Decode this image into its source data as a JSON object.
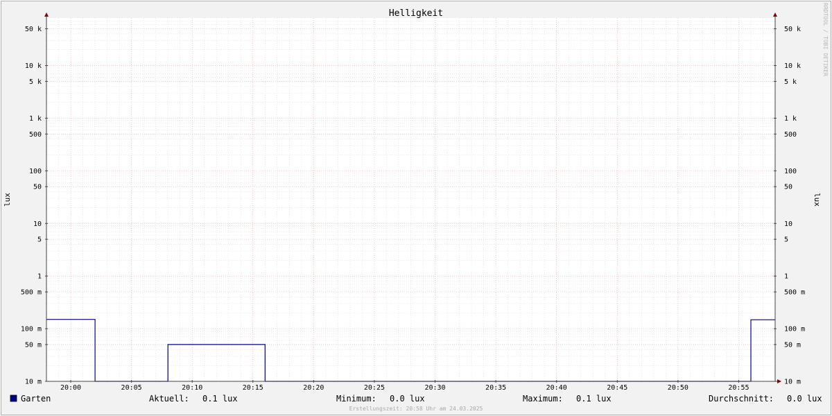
{
  "chart_data": {
    "type": "line",
    "title": "Helligkeit",
    "ylabel": "lux",
    "ylabel_right": "lux",
    "yscale": "log",
    "ylim": [
      0.01,
      80000
    ],
    "y_ticks": [
      {
        "value": 0.01,
        "label": "10 m"
      },
      {
        "value": 0.05,
        "label": "50 m"
      },
      {
        "value": 0.1,
        "label": "100 m"
      },
      {
        "value": 0.5,
        "label": "500 m"
      },
      {
        "value": 1,
        "label": "1"
      },
      {
        "value": 5,
        "label": "5"
      },
      {
        "value": 10,
        "label": "10"
      },
      {
        "value": 50,
        "label": "50"
      },
      {
        "value": 100,
        "label": "100"
      },
      {
        "value": 500,
        "label": "500"
      },
      {
        "value": 1000,
        "label": "1 k"
      },
      {
        "value": 5000,
        "label": "5 k"
      },
      {
        "value": 10000,
        "label": "10 k"
      },
      {
        "value": 50000,
        "label": "50 k"
      }
    ],
    "xlim": [
      "19:58",
      "20:58"
    ],
    "x_ticks": [
      "20:00",
      "20:05",
      "20:10",
      "20:15",
      "20:20",
      "20:25",
      "20:30",
      "20:35",
      "20:40",
      "20:45",
      "20:50",
      "20:55"
    ],
    "grid": true,
    "series": [
      {
        "name": "Garten",
        "color": "#00008b",
        "x": [
          "19:58",
          "20:02",
          "20:02",
          "20:08",
          "20:08",
          "20:16",
          "20:16",
          "20:56",
          "20:56",
          "20:58"
        ],
        "y": [
          0.15,
          0.15,
          0.01,
          0.01,
          0.05,
          0.05,
          0.01,
          0.01,
          0.148,
          0.148
        ]
      }
    ],
    "legend": {
      "position": "bottom",
      "series_name": "Garten",
      "swatch_color": "#00008b",
      "stats": [
        {
          "label": "Aktuell:",
          "value": "0.1 lux"
        },
        {
          "label": "Minimum:",
          "value": "0.0 lux"
        },
        {
          "label": "Maximum:",
          "value": "0.1 lux"
        },
        {
          "label": "Durchschnitt:",
          "value": "0.0 lux"
        }
      ]
    },
    "footer": "Erstellungszeit: 20:58 Uhr am 24.03.2025",
    "watermark": "RRDTOOL / TOBI OETIKER"
  }
}
